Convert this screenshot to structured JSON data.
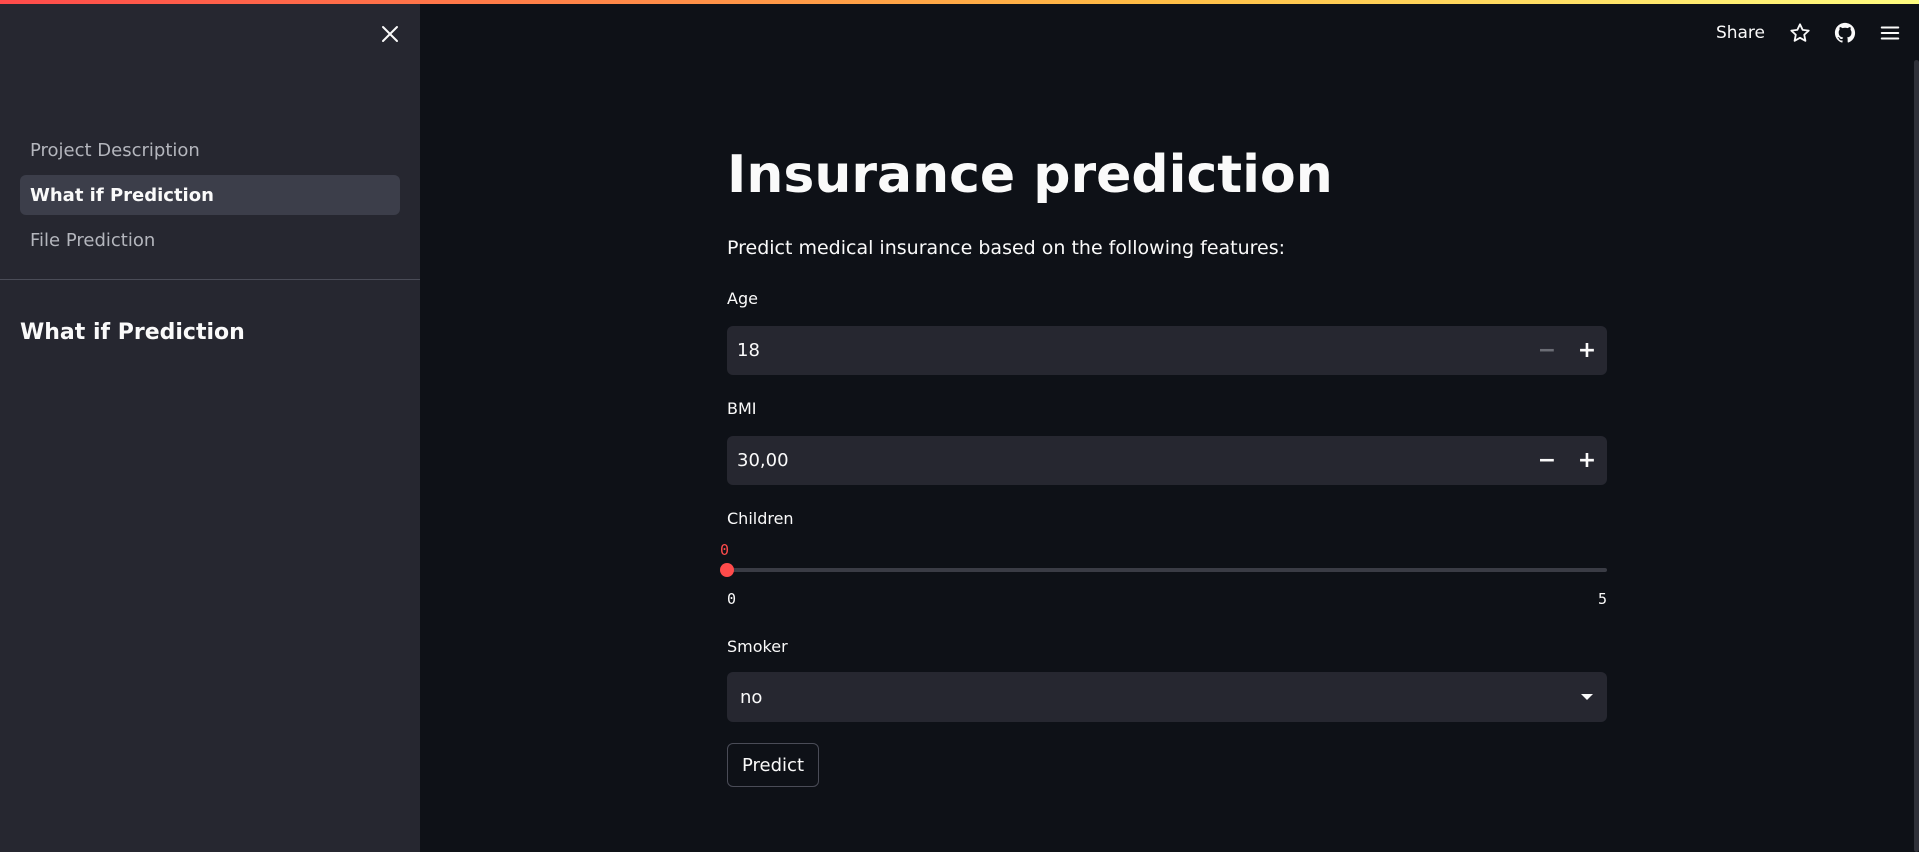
{
  "sidebar": {
    "nav_items": [
      {
        "label": "Project Description",
        "active": false
      },
      {
        "label": "What if Prediction",
        "active": true
      },
      {
        "label": "File Prediction",
        "active": false
      }
    ],
    "heading": "What if Prediction",
    "close_icon": "close-icon"
  },
  "header": {
    "share_label": "Share",
    "icons": [
      "star-icon",
      "github-icon",
      "hamburger-menu-icon"
    ]
  },
  "main": {
    "title": "Insurance prediction",
    "subtitle": "Predict medical insurance based on the following features:",
    "age": {
      "label": "Age",
      "value": "18",
      "minus": "−",
      "plus": "+"
    },
    "bmi": {
      "label": "BMI",
      "value": "30,00",
      "minus": "−",
      "plus": "+"
    },
    "children": {
      "label": "Children",
      "current": "0",
      "min": "0",
      "max": "5",
      "level": 0
    },
    "smoker": {
      "label": "Smoker",
      "selected": "no"
    },
    "predict_label": "Predict"
  },
  "colors": {
    "accent": "#ff4b4b",
    "background": "#0e1117",
    "sidebar": "#262730",
    "input": "#262730"
  }
}
